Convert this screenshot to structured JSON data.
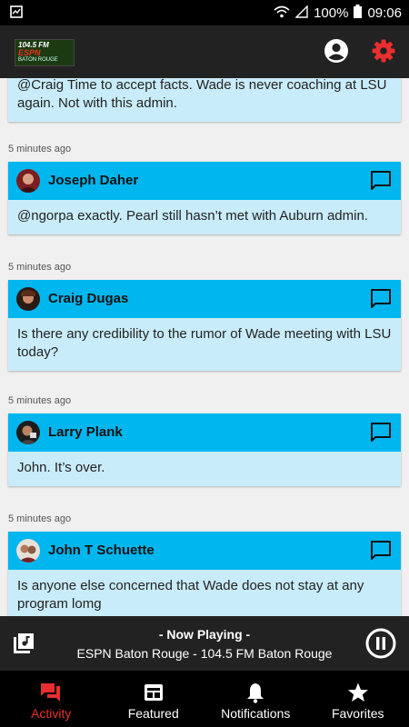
{
  "status_bar": {
    "battery": "100%",
    "time": "09:06"
  },
  "app_bar": {
    "logo_line1": "104.5 FM",
    "logo_line2": "ESPN",
    "logo_line3": "BATON ROUGE",
    "account_icon": "account-circle-icon",
    "settings_icon": "gear-icon",
    "accent_color": "#e82e2e"
  },
  "feed": {
    "partial_post": {
      "text": "@Craig Time to accept facts. Wade is never coaching at LSU again. Not with this admin."
    },
    "posts": [
      {
        "time": "5 minutes ago",
        "user": "Joseph Daher",
        "text": "@ngorpa exactly. Pearl still hasn’t met with Auburn admin."
      },
      {
        "time": "5 minutes ago",
        "user": "Craig Dugas",
        "text": "Is there any credibility to the rumor of Wade meeting with LSU today?"
      },
      {
        "time": "5 minutes ago",
        "user": "Larry Plank",
        "text": "John. It’s over."
      },
      {
        "time": "5 minutes ago",
        "user": "John T Schuette",
        "text": "Is anyone else concerned that Wade does not stay at any program lomg"
      }
    ],
    "header_color": "#00b6ee",
    "body_color": "#c9ecfa"
  },
  "player": {
    "now_playing": "- Now Playing -",
    "station": "ESPN Baton Rouge - 104.5 FM Baton Rouge",
    "queue_icon": "queue-music-icon",
    "pause_icon": "pause-circle-icon"
  },
  "bottom_nav": {
    "activity": "Activity",
    "featured": "Featured",
    "notifications": "Notifications",
    "favorites": "Favorites"
  }
}
